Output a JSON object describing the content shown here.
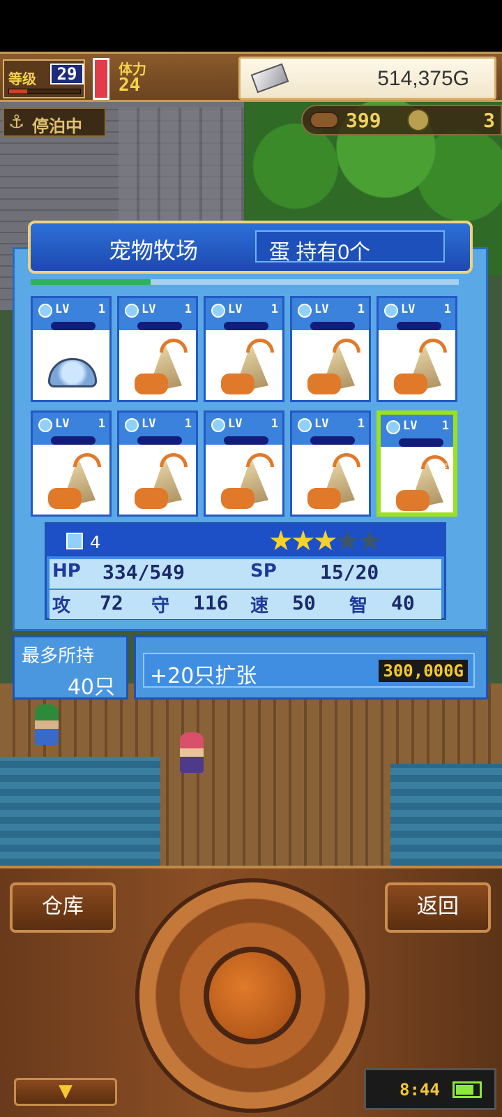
{
  "hud": {
    "level_label": "等级",
    "level": "29",
    "level_progress": 0.25,
    "stamina_label": "体力",
    "stamina": "24",
    "gold": "514,375G",
    "status": "停泊中",
    "wood": "399",
    "coins": "3"
  },
  "dialog": {
    "title": "宠物牧场",
    "eggs": "蛋 持有0个",
    "progress": 0.28
  },
  "pets": [
    {
      "kind": "turtle",
      "lv_label": "LV",
      "lv": "1"
    },
    {
      "kind": "crab",
      "lv_label": "LV",
      "lv": "1"
    },
    {
      "kind": "crab",
      "lv_label": "LV",
      "lv": "1"
    },
    {
      "kind": "crab",
      "lv_label": "LV",
      "lv": "1"
    },
    {
      "kind": "crab",
      "lv_label": "LV",
      "lv": "1"
    },
    {
      "kind": "crab",
      "lv_label": "LV",
      "lv": "1"
    },
    {
      "kind": "crab",
      "lv_label": "LV",
      "lv": "1"
    },
    {
      "kind": "crab",
      "lv_label": "LV",
      "lv": "1"
    },
    {
      "kind": "crab",
      "lv_label": "LV",
      "lv": "1"
    },
    {
      "kind": "crab",
      "lv_label": "LV",
      "lv": "1",
      "selected": true
    }
  ],
  "selected_pet": {
    "gem_count": "4",
    "stars": 3,
    "stars_max": 5,
    "hp_label": "HP",
    "hp": "334/549",
    "sp_label": "SP",
    "sp": "15/20",
    "atk_label": "攻",
    "atk": "72",
    "def_label": "守",
    "def": "116",
    "spd_label": "速",
    "spd": "50",
    "int_label": "智",
    "int": "40"
  },
  "capacity": {
    "label": "最多所持",
    "value": "40只",
    "expand_label": "+20只扩张",
    "expand_price": "300,000G"
  },
  "controls": {
    "warehouse": "仓库",
    "back": "返回",
    "down_arrow": "▼",
    "clock": "8:44",
    "battery_level": 0.8
  },
  "icons": {
    "anchor": "anchor-icon",
    "gem": "gem-icon",
    "silver": "silver-ingot-icon",
    "wood": "wood-icon",
    "coin": "coin-icon",
    "pointer": "hand-pointer-icon"
  },
  "colors": {
    "panel_blue": "#3b82dc",
    "select_green": "#9ce21a",
    "star_gold": "#f7d22c",
    "wood_brown": "#8a4e24"
  }
}
